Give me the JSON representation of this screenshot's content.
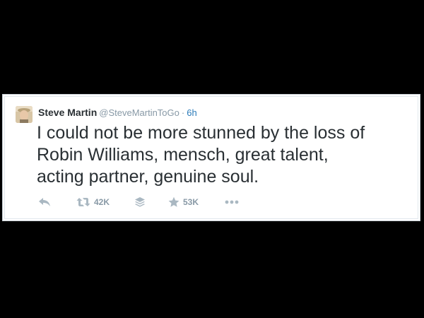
{
  "tweet": {
    "author": {
      "display_name": "Steve Martin",
      "screen_name": "@SteveMartinToGo",
      "avatar_icon": "avatar-photo"
    },
    "separator": "·",
    "timestamp": "6h",
    "text_lines": [
      "I could not be more stunned by the loss of",
      "Robin Williams, mensch, great talent,",
      "acting partner, genuine soul."
    ],
    "actions": {
      "reply": {
        "icon": "reply-icon"
      },
      "retweet": {
        "icon": "retweet-icon",
        "count": "42K"
      },
      "buffer": {
        "icon": "stack-icon"
      },
      "favorite": {
        "icon": "star-icon",
        "count": "53K"
      },
      "more": {
        "icon": "more-icon"
      }
    }
  },
  "colors": {
    "background": "#000000",
    "card": "#ffffff",
    "text": "#292f33",
    "muted": "#8899a6",
    "icon": "#aab8c2",
    "link": "#2b7bb9"
  }
}
